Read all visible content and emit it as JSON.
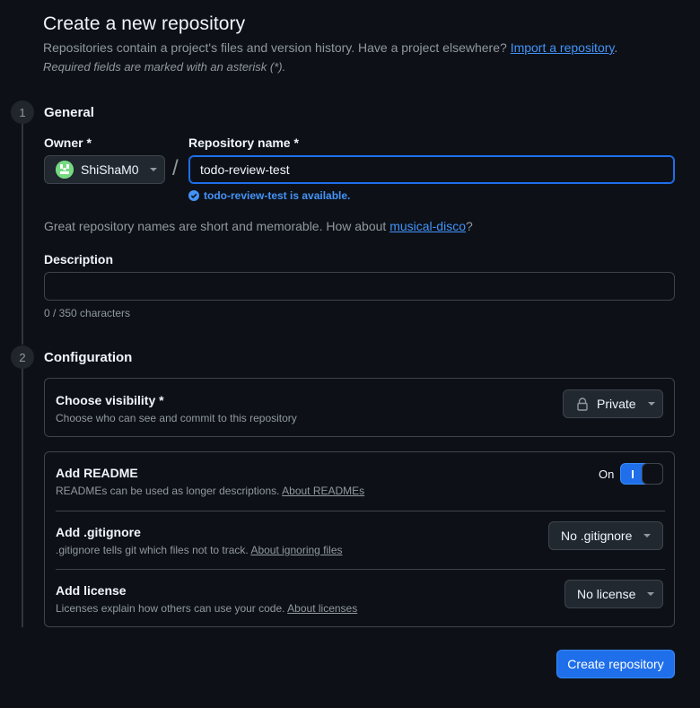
{
  "page": {
    "title": "Create a new repository",
    "intro_text": "Repositories contain a project's files and version history. Have a project elsewhere?",
    "import_link": "Import a repository",
    "intro_end": ".",
    "required_note": "Required fields are marked with an asterisk (*)."
  },
  "general": {
    "step": "1",
    "title": "General",
    "owner_label": "Owner *",
    "owner_value": "ShiShaM0",
    "separator": "/",
    "repo_label": "Repository name *",
    "repo_value": "todo-review-test",
    "availability": "todo-review-test is available.",
    "suggestion_text": "Great repository names are short and memorable. How about",
    "suggestion_link": "musical-disco",
    "suggestion_end": "?",
    "description_label": "Description",
    "description_value": "",
    "char_count": "0 / 350 characters"
  },
  "configuration": {
    "step": "2",
    "title": "Configuration",
    "visibility": {
      "title": "Choose visibility *",
      "desc": "Choose who can see and commit to this repository",
      "value": "Private"
    },
    "readme": {
      "title": "Add README",
      "desc": "READMEs can be used as longer descriptions.",
      "link": "About READMEs",
      "toggle_label": "On"
    },
    "gitignore": {
      "title": "Add .gitignore",
      "desc": ".gitignore tells git which files not to track.",
      "link": "About ignoring files",
      "value": "No .gitignore"
    },
    "license": {
      "title": "Add license",
      "desc": "Licenses explain how others can use your code.",
      "link": "About licenses",
      "value": "No license"
    }
  },
  "actions": {
    "create_label": "Create repository"
  },
  "colors": {
    "background": "#0d1117",
    "accent": "#1f6feb",
    "link": "#4493f8",
    "border": "#3d444d"
  }
}
